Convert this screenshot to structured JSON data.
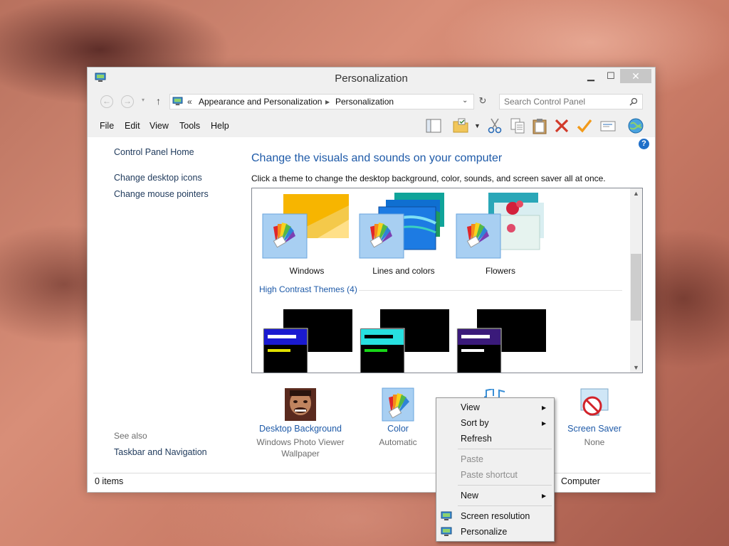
{
  "window": {
    "title": "Personalization",
    "buttons": {
      "minimize": "▁",
      "maximize": "☐",
      "close": "✕"
    }
  },
  "address": {
    "overflow": "«",
    "crumbs": [
      "Appearance and Personalization",
      "Personalization"
    ],
    "search_placeholder": "Search Control Panel"
  },
  "menubar": {
    "items": [
      "File",
      "Edit",
      "View",
      "Tools",
      "Help"
    ]
  },
  "leftnav": {
    "home": "Control Panel Home",
    "links": [
      "Change desktop icons",
      "Change mouse pointers"
    ],
    "see_also_label": "See also",
    "see_also_links": [
      "Taskbar and Navigation"
    ]
  },
  "main": {
    "heading": "Change the visuals and sounds on your computer",
    "subtext": "Click a theme to change the desktop background, color, sounds, and screen saver all at once.",
    "themes": [
      "Windows",
      "Lines and colors",
      "Flowers"
    ],
    "high_contrast_group": "High Contrast Themes (4)"
  },
  "bottom": {
    "desktop_background": {
      "label": "Desktop Background",
      "sub1": "Windows Photo Viewer",
      "sub2": "Wallpaper"
    },
    "color": {
      "label": "Color",
      "sub1": "Automatic"
    },
    "screen_saver": {
      "label": "Screen Saver",
      "sub1": "None"
    }
  },
  "status": {
    "items": "0 items",
    "location": "Computer"
  },
  "context_menu": {
    "view": "View",
    "sort_by": "Sort by",
    "refresh": "Refresh",
    "paste": "Paste",
    "paste_shortcut": "Paste shortcut",
    "new": "New",
    "screen_resolution": "Screen resolution",
    "personalize": "Personalize"
  }
}
